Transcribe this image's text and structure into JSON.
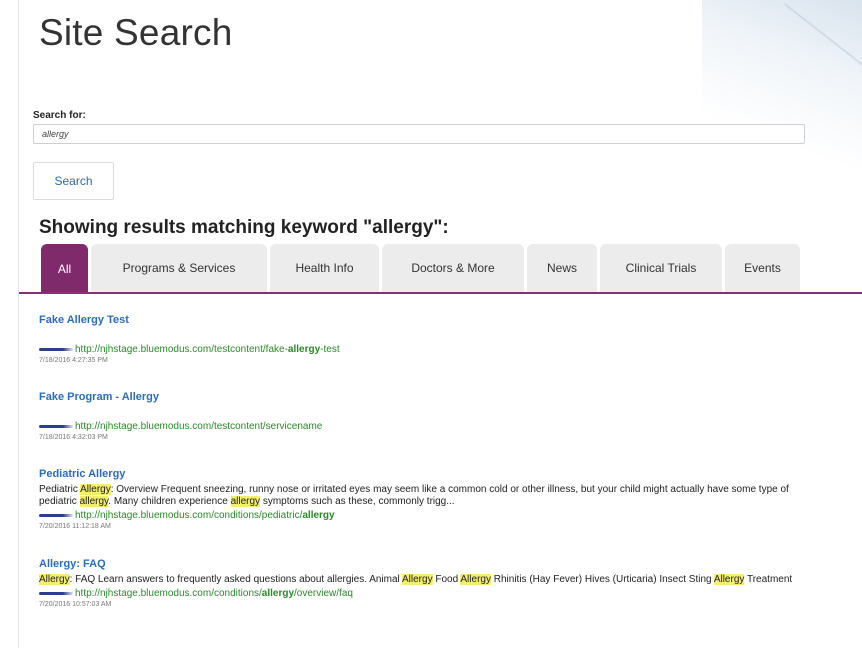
{
  "page": {
    "title": "Site Search",
    "search_label": "Search for:",
    "search_value": "allergy",
    "search_button": "Search",
    "results_heading": "Showing results matching keyword \"allergy\":"
  },
  "tabs": [
    {
      "label": "All",
      "active": true
    },
    {
      "label": "Programs & Services",
      "active": false
    },
    {
      "label": "Health Info",
      "active": false
    },
    {
      "label": "Doctors & More",
      "active": false
    },
    {
      "label": "News",
      "active": false
    },
    {
      "label": "Clinical Trials",
      "active": false
    },
    {
      "label": "Events",
      "active": false
    }
  ],
  "results": [
    {
      "title": "Fake Allergy Test",
      "url_prefix": "http://njhstage.bluemodus.com/testcontent/fake-",
      "url_keyword": "allergy",
      "url_suffix": "-test",
      "date": "7/18/2016 4:27:35 PM"
    },
    {
      "title": "Fake Program - Allergy",
      "url_prefix": "http://njhstage.bluemodus.com/testcontent/servicename",
      "url_keyword": "",
      "url_suffix": "",
      "date": "7/18/2016 4:32:03 PM"
    },
    {
      "title": "Pediatric Allergy",
      "snippet": {
        "p1": "Pediatric ",
        "k1": "Allergy",
        "p2": ": Overview  Frequent sneezing, runny nose or irritated eyes may seem like a common cold or other illness, but your child might actually have some type of pediatric ",
        "k2": "allergy",
        "p3": ". Many children experience ",
        "k3": "allergy",
        "p4": " symptoms such as these, commonly trigg..."
      },
      "url_prefix": "http://njhstage.bluemodus.com/conditions/pediatric/",
      "url_keyword": "allergy",
      "url_suffix": "",
      "date": "7/20/2016 11:12:18 AM"
    },
    {
      "title": "Allergy: FAQ",
      "snippet": {
        "k1": "Allergy",
        "p1": ": FAQ Learn answers to frequently asked questions about allergies. Animal ",
        "k2": "Allergy",
        "p2": " Food ",
        "k3": "Allergy",
        "p3": " Rhinitis (Hay Fever) Hives (Urticaria) Insect Sting ",
        "k4": "Allergy",
        "p4": " Treatment"
      },
      "url_prefix": "http://njhstage.bluemodus.com/conditions/",
      "url_keyword": "allergy",
      "url_suffix": "/overview/faq",
      "date": "7/20/2016 10:57:03 AM"
    }
  ],
  "colors": {
    "accent": "#7e2a6b",
    "link": "#2a6cc0",
    "url": "#2a8a2a",
    "highlight": "#f4ef6a"
  }
}
